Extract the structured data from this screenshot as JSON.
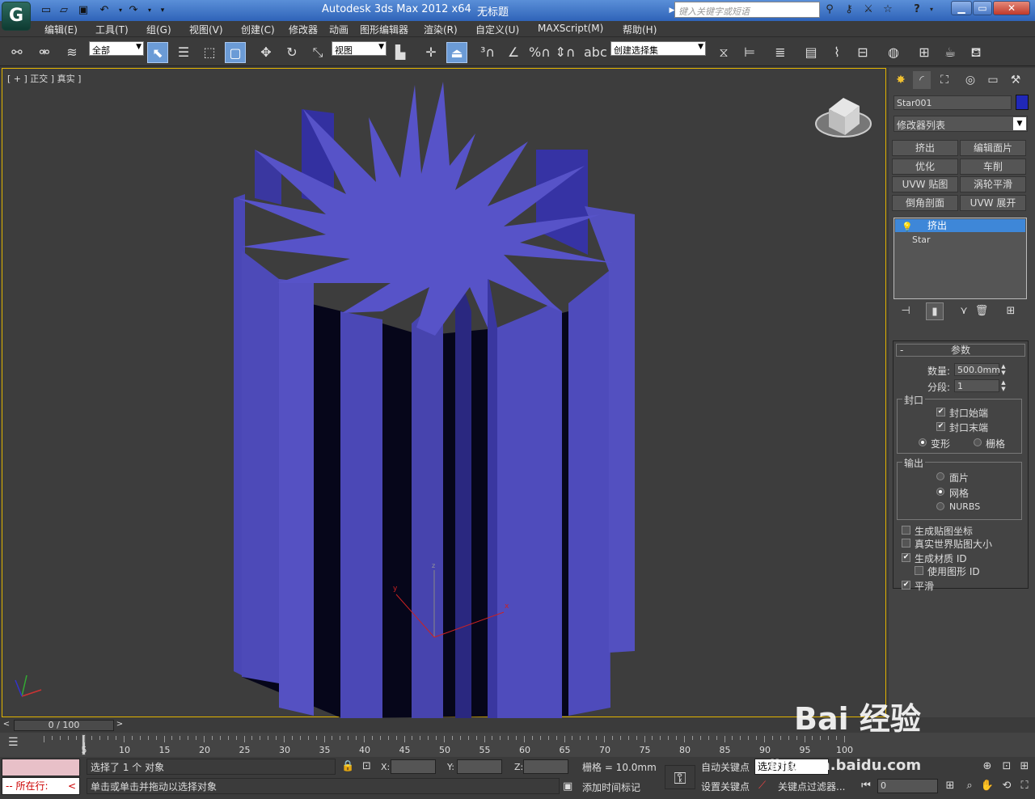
{
  "titlebar": {
    "app_title": "Autodesk 3ds Max  2012 x64",
    "document_title": "无标题",
    "search_placeholder": "键入关键字或短语",
    "help_label": "?"
  },
  "menu": [
    "编辑(E)",
    "工具(T)",
    "组(G)",
    "视图(V)",
    "创建(C)",
    "修改器",
    "动画",
    "图形编辑器",
    "渲染(R)",
    "自定义(U)",
    "MAXScript(M)",
    "帮助(H)"
  ],
  "toolbar": {
    "selection_filter": "全部",
    "ref_coord": "视图",
    "named_selection_set": "创建选择集"
  },
  "viewport": {
    "label": "[ + ] 正交 ] 真实 ]",
    "object_color": "#5a55c8",
    "axes": {
      "x": "x",
      "y": "y",
      "z": "z"
    }
  },
  "command_panel": {
    "object_name": "Star001",
    "object_color": "#2028b8",
    "modifier_list": "修改器列表",
    "modifier_buttons": [
      "挤出",
      "编辑面片",
      "优化",
      "车削",
      "UVW 贴图",
      "涡轮平滑",
      "倒角剖面",
      "UVW 展开"
    ],
    "stack": {
      "selected": "挤出",
      "base": "Star"
    },
    "params": {
      "header": "参数",
      "amount_label": "数量:",
      "amount_value": "500.0mm",
      "segments_label": "分段:",
      "segments_value": "1",
      "capping_title": "封口",
      "cap_start": "封口始端",
      "cap_end": "封口末端",
      "morph": "变形",
      "grid": "栅格",
      "output_title": "输出",
      "patch": "面片",
      "mesh": "网格",
      "nurbs": "NURBS",
      "gen_mapping": "生成贴图坐标",
      "real_world": "真实世界贴图大小",
      "gen_mat_ids": "生成材质 ID",
      "use_shape_ids": "使用图形 ID",
      "smooth": "平滑"
    }
  },
  "timeline": {
    "frame_display": "0 / 100",
    "ticks": [
      "0",
      "5",
      "10",
      "15",
      "20",
      "25",
      "30",
      "35",
      "40",
      "45",
      "50",
      "55",
      "60",
      "65",
      "70",
      "75",
      "80",
      "85",
      "90",
      "95",
      "100"
    ]
  },
  "status": {
    "listener_text": "所在行:",
    "selected": "选择了 1 个 对象",
    "prompt": "单击或单击并拖动以选择对象",
    "x_label": "X:",
    "y_label": "Y:",
    "z_label": "Z:",
    "grid": "栅格 = 10.0mm",
    "add_time_tag": "添加时间标记",
    "auto_key": "自动关键点",
    "set_key": "设置关键点",
    "selected_object": "选定对象",
    "key_filters": "关键点过滤器...",
    "frame": "0"
  },
  "watermark": {
    "brand": "Bai 经验",
    "url": "jingyan.baidu.com"
  }
}
